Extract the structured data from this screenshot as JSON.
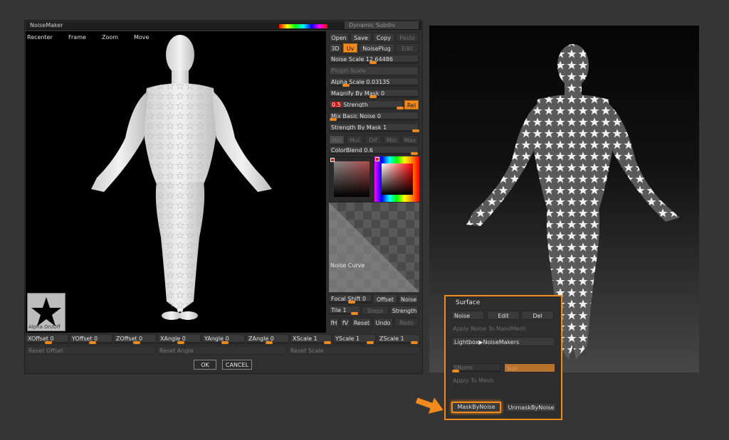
{
  "window": {
    "title": "NoiseMaker",
    "top_label": "Dynamic Subdiv"
  },
  "viewport": {
    "nav": [
      "Recenter",
      "Frame",
      "Zoom",
      "Move"
    ],
    "alpha_label": "Alpha On/Off"
  },
  "file_buttons": [
    "Open",
    "Save",
    "Copy",
    "Paste"
  ],
  "mode_buttons": [
    "3D",
    "Uv",
    "NoisePlug",
    "Edit"
  ],
  "sliders": {
    "noise_scale": "Noise Scale 12.64486",
    "plugin_scale": "Plugin Scale",
    "alpha_scale": "Alpha Scale 0.03135",
    "magnify_by_mask": "Magnify By Mask 0",
    "strength_value": "0.5",
    "strength_label": "Strength",
    "rel": "Rel",
    "mix_basic_noise": "Mix Basic Noise 0",
    "strength_by_mask": "Strength By Mask 1",
    "color_blend": "ColorBlend 0.6"
  },
  "blend_modes": [
    "Mix",
    "Mul",
    "Dif",
    "Min",
    "Max"
  ],
  "noise_curve": "Noise Curve",
  "curve_controls": {
    "focal_shift": "Focal Shift 0",
    "offset": "Offset",
    "noise": "Noise",
    "tile": "Tile 1",
    "steps": "Steps",
    "strength": "Strength"
  },
  "curve_buttons": [
    "fH",
    "fV",
    "Reset",
    "Undo",
    "Redo"
  ],
  "offsets": [
    "XOffset 0",
    "YOffset 0",
    "ZOffset 0",
    "XAngle 0",
    "YAngle 0",
    "ZAngle 0",
    "XScale 1",
    "YScale 1",
    "ZScale 1"
  ],
  "resets": [
    "Reset Offset",
    "Reset Angle",
    "Reset Scale"
  ],
  "dialog": {
    "ok": "OK",
    "cancel": "CANCEL"
  },
  "surface": {
    "title": "Surface",
    "noise": "Noise",
    "edit": "Edit",
    "del": "Del",
    "apply_noise": "Apply Noise To NanoMesh",
    "lightbox": "Lightbox▶NoiseMakers",
    "snorm": "SNorm",
    "suv": "Suv",
    "apply_mesh": "Apply To Mesh",
    "mask_by_noise": "MaskByNoise",
    "unmask_by_noise": "UnmaskByNoise"
  },
  "colors": {
    "accent": "#f08a1c",
    "highlight": "#c01010"
  }
}
